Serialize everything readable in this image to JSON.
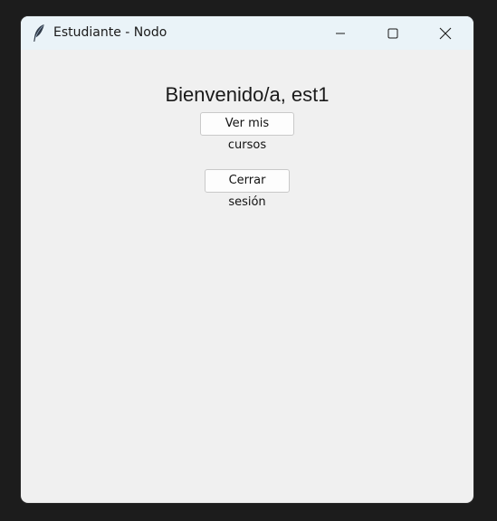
{
  "window": {
    "title": "Estudiante - Nodo",
    "icon": "feather-icon",
    "controls": {
      "minimize": "minimize-icon",
      "maximize": "maximize-icon",
      "close": "close-icon"
    }
  },
  "main": {
    "welcome_text": "Bienvenido/a, est1",
    "courses_button_label": "Ver mis cursos",
    "logout_button_label": "Cerrar sesión"
  },
  "colors": {
    "titlebar_bg": "#eaf3f8",
    "window_bg": "#f0f0f0",
    "desktop_bg": "#1c1c1c"
  }
}
